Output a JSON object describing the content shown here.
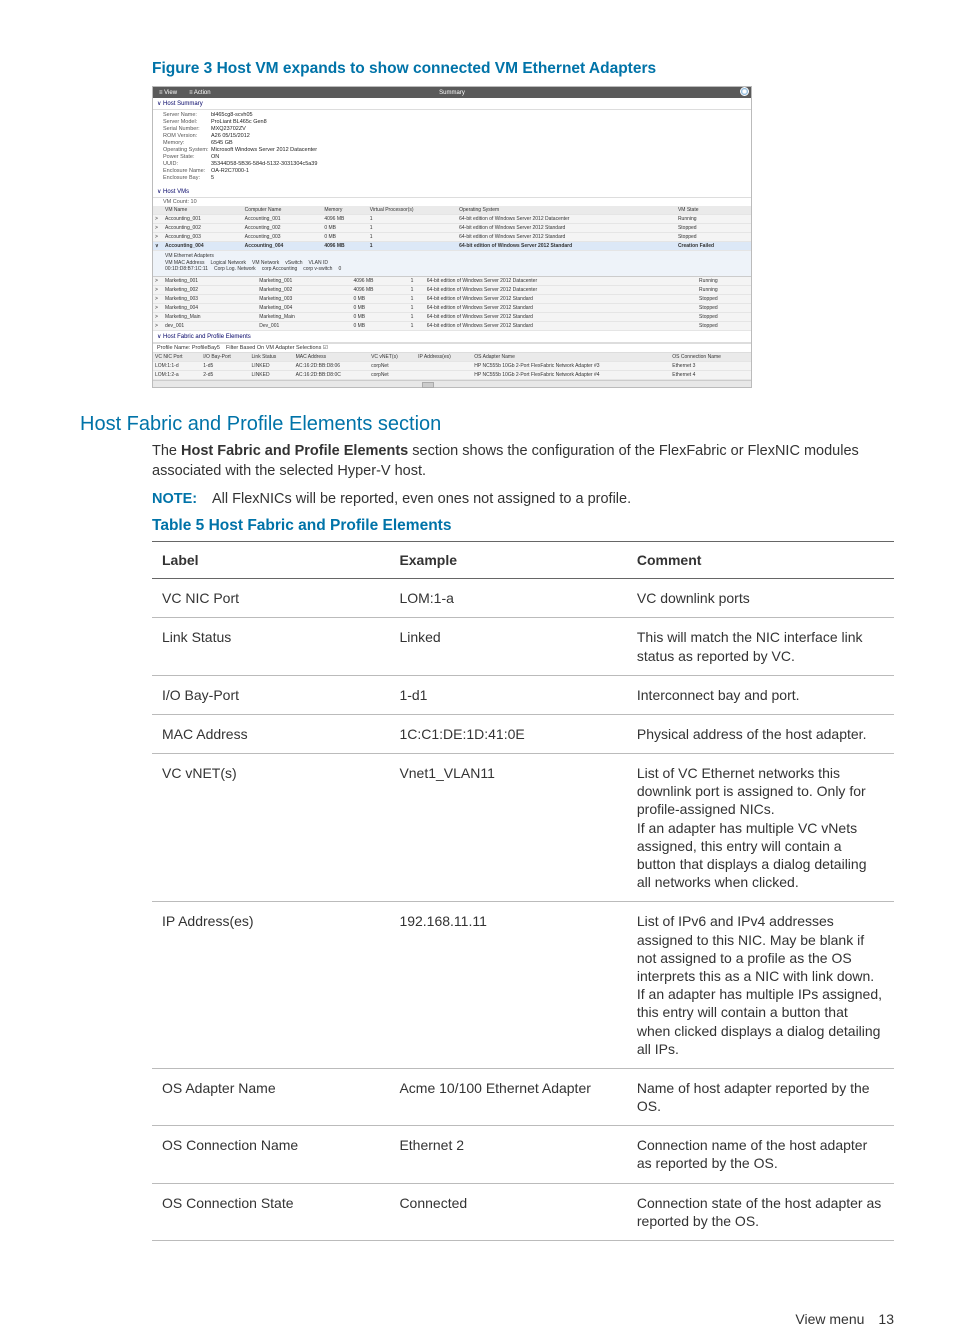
{
  "figure": {
    "title": "Figure 3 Host VM expands to show connected VM Ethernet Adapters"
  },
  "screenshot": {
    "menu": {
      "view": "≡ View",
      "action": "≡ Action",
      "summary": "Summary"
    },
    "hostSummary": {
      "header": "∨ Host Summary",
      "rows": [
        {
          "k": "Server Name:",
          "v": "bl465cg8-scvh05"
        },
        {
          "k": "Server Model:",
          "v": "ProLiant BL465c Gen8"
        },
        {
          "k": "Serial Number:",
          "v": "MXQ23702ZV"
        },
        {
          "k": "ROM Version:",
          "v": "A26 05/15/2012"
        },
        {
          "k": "Memory:",
          "v": "6545 GB"
        },
        {
          "k": "Operating System:",
          "v": "Microsoft Windows Server 2012 Datacenter"
        },
        {
          "k": "Power State:",
          "v": "ON"
        },
        {
          "k": "UUID:",
          "v": "35344D58-5B36-584d-5132-3031304c5a39"
        },
        {
          "k": "Enclosure Name:",
          "v": "OA-R2C7000-1"
        },
        {
          "k": "Enclosure Bay:",
          "v": "5"
        }
      ]
    },
    "hostVMs": {
      "header": "∨ Host VMs",
      "count": "VM Count: 10",
      "cols": [
        "VM Name",
        "Computer Name",
        "Memory",
        "Virtual Processor(s)",
        "Operating System",
        "VM State"
      ],
      "rows": [
        {
          "d": [
            "Accounting_001",
            "Accounting_001",
            "4096 MB",
            "1",
            "64-bit edition of Windows Server 2012 Datacenter",
            "Running"
          ],
          "sel": false,
          "exp": ">"
        },
        {
          "d": [
            "Accounting_002",
            "Accounting_002",
            "0 MB",
            "1",
            "64-bit edition of Windows Server 2012 Standard",
            "Stopped"
          ],
          "sel": false,
          "exp": ">"
        },
        {
          "d": [
            "Accounting_003",
            "Accounting_003",
            "0 MB",
            "1",
            "64-bit edition of Windows Server 2012 Standard",
            "Stopped"
          ],
          "sel": false,
          "exp": ">"
        },
        {
          "d": [
            "Accounting_004",
            "Accounting_004",
            "4096 MB",
            "1",
            "64-bit edition of Windows Server 2012 Standard",
            "Creation Failed"
          ],
          "sel": true,
          "exp": "∨"
        }
      ],
      "sub": {
        "title": "VM Ethernet Adapters",
        "hdr": [
          "VM MAC Address",
          "Logical Network",
          "VM Network",
          "vSwitch",
          "VLAN ID"
        ],
        "row": [
          "00:1D:D8:B7:1C:11",
          "Corp Log. Network",
          "corp Accounting",
          "corp v-switch",
          "0"
        ]
      },
      "rows2": [
        {
          "d": [
            "Marketing_001",
            "Marketing_001",
            "4096 MB",
            "1",
            "64-bit edition of Windows Server 2012 Datacenter",
            "Running"
          ],
          "exp": ">"
        },
        {
          "d": [
            "Marketing_002",
            "Marketing_002",
            "4096 MB",
            "1",
            "64-bit edition of Windows Server 2012 Datacenter",
            "Running"
          ],
          "exp": ">"
        },
        {
          "d": [
            "Marketing_003",
            "Marketing_003",
            "0 MB",
            "1",
            "64-bit edition of Windows Server 2012 Standard",
            "Stopped"
          ],
          "exp": ">"
        },
        {
          "d": [
            "Marketing_004",
            "Marketing_004",
            "0 MB",
            "1",
            "64-bit edition of Windows Server 2012 Standard",
            "Stopped"
          ],
          "exp": ">"
        },
        {
          "d": [
            "Marketing_Main",
            "Marketing_Main",
            "0 MB",
            "1",
            "64-bit edition of Windows Server 2012 Standard",
            "Stopped"
          ],
          "exp": ">"
        },
        {
          "d": [
            "dev_001",
            "Dev_001",
            "0 MB",
            "1",
            "64-bit edition of Windows Server 2012 Standard",
            "Stopped"
          ],
          "exp": ">"
        }
      ]
    },
    "fabric": {
      "header": "∨ Host Fabric and Profile Elements",
      "profile_label": "Profile Name: ProfileBay5",
      "filter_label": "Filter Based On VM Adapter Selections ☑",
      "cols": [
        "VC NIC Port",
        "I/O Bay-Port",
        "Link Status",
        "MAC Address",
        "VC vNET(s)",
        "IP Address(es)",
        "OS Adapter Name",
        "OS Connection Name"
      ],
      "rows": [
        [
          "LOM:1:1-d",
          "1-d5",
          "LINKED",
          "AC:16:2D:BB:D8:06",
          "corpNet",
          "",
          "HP NC555b 10Gb 2-Port FlexFabric Network Adapter #3",
          "Ethernet 3"
        ],
        [
          "LOM:1:2-a",
          "2-d5",
          "LINKED",
          "AC:16:2D:BB:D8:0C",
          "corpNet",
          "",
          "HP NC555b 10Gb 2-Port FlexFabric Network Adapter #4",
          "Ethernet 4"
        ]
      ]
    }
  },
  "section": {
    "title": "Host Fabric and Profile Elements section",
    "para_pre": "The ",
    "para_bold": "Host Fabric and Profile Elements",
    "para_post": " section shows the configuration of the FlexFabric or FlexNIC modules associated with the selected Hyper-V host.",
    "note_label": "NOTE:",
    "note_text": "All FlexNICs will be reported, even ones not assigned to a profile."
  },
  "table": {
    "title": "Table 5 Host Fabric and Profile Elements",
    "headers": [
      "Label",
      "Example",
      "Comment"
    ],
    "rows": [
      {
        "label": "VC NIC Port",
        "example": "LOM:1-a",
        "comment": "VC downlink ports"
      },
      {
        "label": "Link Status",
        "example": "Linked",
        "comment": "This will match the NIC interface link status as reported by VC."
      },
      {
        "label": "I/O Bay-Port",
        "example": "1-d1",
        "comment": "Interconnect bay and port."
      },
      {
        "label": "MAC Address",
        "example": "1C:C1:DE:1D:41:0E",
        "comment": "Physical address of the host adapter."
      },
      {
        "label": "VC vNET(s)",
        "example": "Vnet1_VLAN11",
        "comment": "List of VC Ethernet networks this downlink port is assigned to. Only for profile-assigned NICs.\nIf an adapter has multiple VC vNets assigned, this entry will contain a button that displays a dialog detailing all networks when clicked."
      },
      {
        "label": "IP Address(es)",
        "example": "192.168.11.11",
        "comment": "List of IPv6 and IPv4 addresses assigned to this NIC. May be blank if not assigned to a profile as the OS interprets this as a NIC with link down. If an adapter has multiple IPs assigned, this entry will contain a button that when clicked displays a dialog detailing all IPs."
      },
      {
        "label": "OS Adapter Name",
        "example": "Acme 10/100 Ethernet Adapter",
        "comment": "Name of host adapter reported by the OS."
      },
      {
        "label": "OS Connection Name",
        "example": "Ethernet 2",
        "comment": "Connection name of the host adapter as reported by the OS."
      },
      {
        "label": "OS Connection State",
        "example": "Connected",
        "comment": "Connection state of the host adapter as reported by the OS."
      }
    ]
  },
  "footer": {
    "label": "View menu",
    "page": "13"
  }
}
